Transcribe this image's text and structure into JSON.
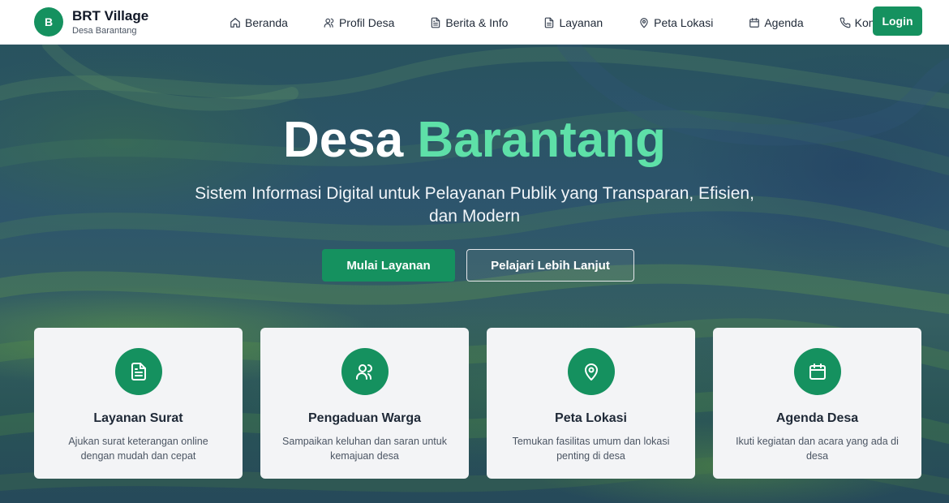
{
  "brand": {
    "logo_letter": "B",
    "title": "BRT Village",
    "subtitle": "Desa Barantang"
  },
  "nav": {
    "items": [
      {
        "label": "Beranda",
        "icon": "home-icon"
      },
      {
        "label": "Profil Desa",
        "icon": "users-icon"
      },
      {
        "label": "Berita & Info",
        "icon": "document-icon"
      },
      {
        "label": "Layanan",
        "icon": "file-icon"
      },
      {
        "label": "Peta Lokasi",
        "icon": "map-pin-icon"
      },
      {
        "label": "Agenda",
        "icon": "calendar-icon"
      },
      {
        "label": "Kontak",
        "icon": "phone-icon"
      }
    ],
    "login_label": "Login"
  },
  "hero": {
    "title_main": "Desa",
    "title_accent": "Barantang",
    "subtitle": "Sistem Informasi Digital untuk Pelayanan Publik yang Transparan, Efisien, dan Modern",
    "primary_button": "Mulai Layanan",
    "secondary_button": "Pelajari Lebih Lanjut"
  },
  "cards": [
    {
      "title": "Layanan Surat",
      "description": "Ajukan surat keterangan online dengan mudah dan cepat",
      "icon": "document-icon"
    },
    {
      "title": "Pengaduan Warga",
      "description": "Sampaikan keluhan dan saran untuk kemajuan desa",
      "icon": "users-icon"
    },
    {
      "title": "Peta Lokasi",
      "description": "Temukan fasilitas umum dan lokasi penting di desa",
      "icon": "map-pin-icon"
    },
    {
      "title": "Agenda Desa",
      "description": "Ikuti kegiatan dan acara yang ada di desa",
      "icon": "calendar-icon"
    }
  ],
  "colors": {
    "brand_green": "#15915f",
    "accent_green": "#5ee0a8"
  }
}
